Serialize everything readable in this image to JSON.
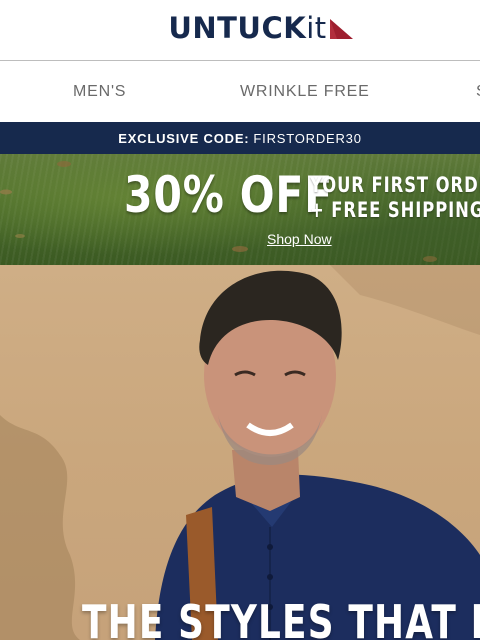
{
  "brand": {
    "name_main": "UNTUCK",
    "name_suffix": "it",
    "mark_color": "#9e1f2f",
    "text_color": "#16294d"
  },
  "nav": {
    "items": [
      {
        "label": "MEN'S"
      },
      {
        "label": "WRINKLE FREE"
      },
      {
        "label": "S"
      }
    ]
  },
  "promo_strip": {
    "label": "EXCLUSIVE CODE:",
    "code": "FIRSTORDER30"
  },
  "banner": {
    "percent_off": "30% OFF",
    "line1": "YOUR FIRST ORDER",
    "line2": "+ FREE SHIPPING",
    "cta": "Shop Now"
  },
  "hero": {
    "headline": "THE STYLES THAT MAD"
  }
}
